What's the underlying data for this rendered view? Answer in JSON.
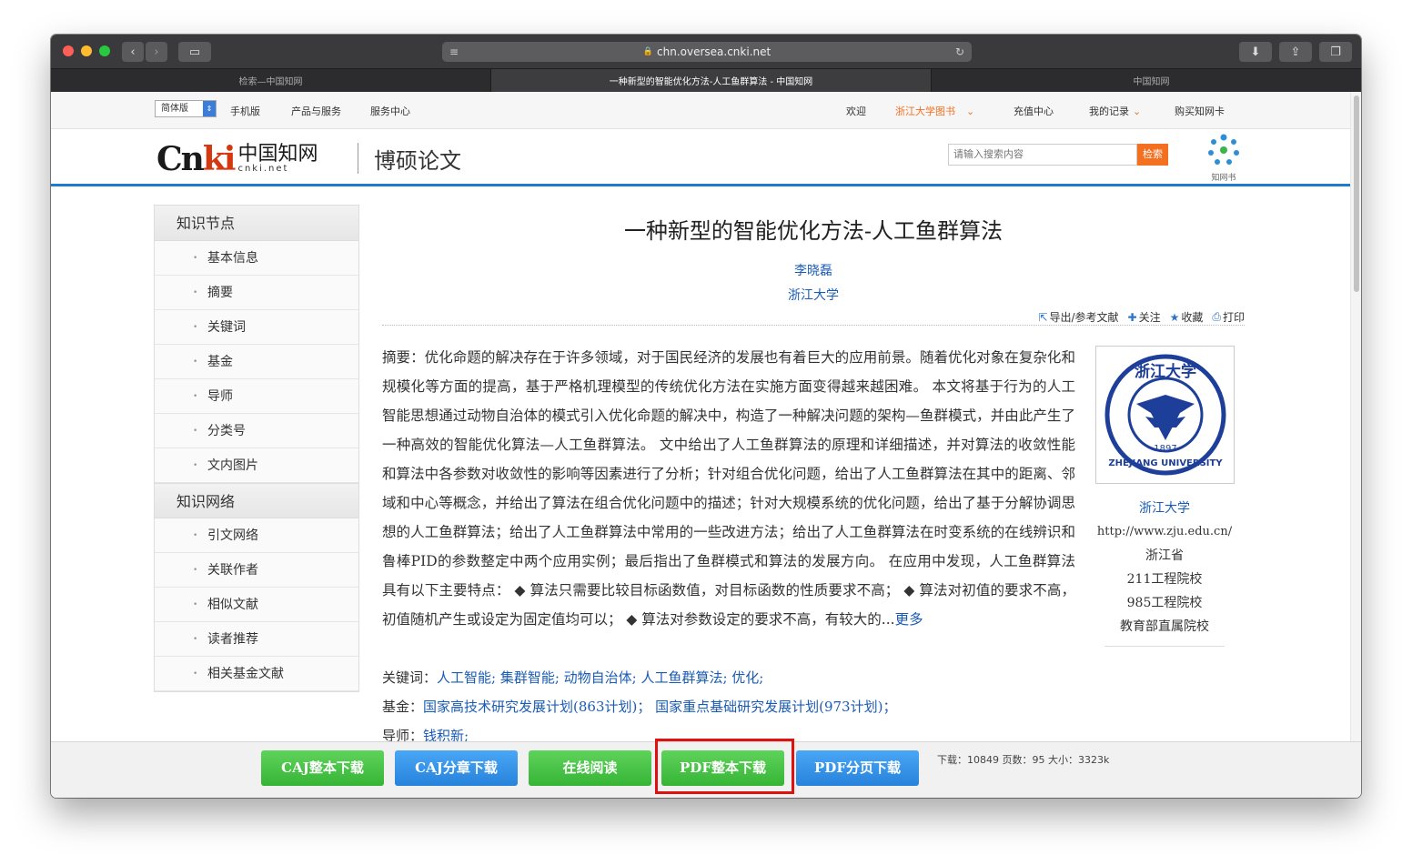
{
  "browser": {
    "url": "chn.oversea.cnki.net",
    "tabs": [
      {
        "label": "检索—中国知网",
        "active": false
      },
      {
        "label": "一种新型的智能优化方法-人工鱼群算法 - 中国知网",
        "active": true
      },
      {
        "label": "中国知网",
        "active": false
      }
    ],
    "new_tab": "+"
  },
  "topnav": {
    "lang": "简体版",
    "mobile": "手机版",
    "products": "产品与服务",
    "service": "服务中心",
    "welcome": "欢迎",
    "library": "浙江大学图书",
    "recharge": "充值中心",
    "records": "我的记录",
    "buy_card": "购买知网卡"
  },
  "header": {
    "logo_c": "Cn",
    "logo_ki": "ki",
    "logo_cn": "中国知网",
    "logo_net": "cnki.net",
    "section": "博硕论文",
    "search_placeholder": "请输入搜索内容",
    "search_btn": "检索",
    "zwbook": "知网书"
  },
  "sidebar": {
    "group1": "知识节点",
    "items1": [
      "基本信息",
      "摘要",
      "关键词",
      "基金",
      "导师",
      "分类号",
      "文内图片"
    ],
    "group2": "知识网络",
    "items2": [
      "引文网络",
      "关联作者",
      "相似文献",
      "读者推荐",
      "相关基金文献"
    ]
  },
  "article": {
    "title": "一种新型的智能优化方法-人工鱼群算法",
    "author": "李晓磊",
    "institution": "浙江大学",
    "tools": {
      "export": "导出/参考文献",
      "follow": "关注",
      "favorite": "收藏",
      "print": "打印"
    },
    "abstract_label": "摘要：",
    "abstract": "优化命题的解决存在于许多领域，对于国民经济的发展也有着巨大的应用前景。随着优化对象在复杂化和规模化等方面的提高，基于严格机理模型的传统优化方法在实施方面变得越来越困难。 本文将基于行为的人工智能思想通过动物自治体的模式引入优化命题的解决中，构造了一种解决问题的架构—鱼群模式，并由此产生了一种高效的智能优化算法—人工鱼群算法。 文中给出了人工鱼群算法的原理和详细描述，并对算法的收敛性能和算法中各参数对收敛性的影响等因素进行了分析；针对组合优化问题，给出了人工鱼群算法在其中的距离、邻域和中心等概念，并给出了算法在组合优化问题中的描述；针对大规模系统的优化问题，给出了基于分解协调思想的人工鱼群算法；给出了人工鱼群算法中常用的一些改进方法；给出了人工鱼群算法在时变系统的在线辨识和鲁棒PID的参数整定中两个应用实例；最后指出了鱼群模式和算法的发展方向。 在应用中发现，人工鱼群算法具有以下主要特点： ◆ 算法只需要比较目标函数值，对目标函数的性质要求不高； ◆ 算法对初值的要求不高，初值随机产生或设定为固定值均可以； ◆ 算法对参数设定的要求不高，有较大的...",
    "more": "更多",
    "keywords_label": "关键词：",
    "keywords": "人工智能; 集群智能; 动物自治体; 人工鱼群算法; 优化;",
    "fund_label": "基金：",
    "fund": "国家高技术研究发展计划(863计划)；  国家重点基础研究发展计划(973计划)；",
    "advisor_label": "导师：",
    "advisor": "钱积新;"
  },
  "university": {
    "name": "浙江大学",
    "url": "http://www.zju.edu.cn/",
    "province": "浙江省",
    "tags": [
      "211工程院校",
      "985工程院校",
      "教育部直属院校"
    ],
    "seal_text": "浙江大学",
    "seal_year": "1897",
    "seal_en": "ZHEJIANG UNIVERSITY"
  },
  "downloads": {
    "caj_full": "CAJ整本下载",
    "caj_chapter": "CAJ分章下载",
    "read_online": "在线阅读",
    "pdf_full": "PDF整本下载",
    "pdf_page": "PDF分页下载",
    "stats": "下载：10849   页数：95   大小：3323k"
  },
  "colors": {
    "accent_blue": "#1d7bd0",
    "link": "#1a5bb5",
    "orange": "#f37021",
    "green": "#36b436",
    "highlight": "#e01010"
  }
}
